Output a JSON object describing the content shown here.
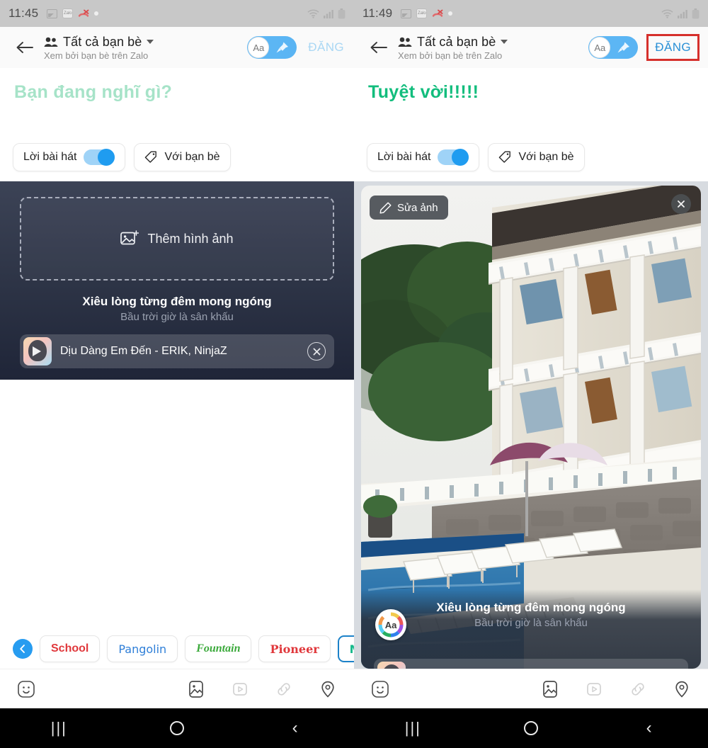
{
  "app": {
    "name": "Zalo",
    "accent": "#2a90d6",
    "caption_green": "#12bd7d",
    "highlight_red": "#d6302c"
  },
  "left": {
    "status": {
      "time": "11:45",
      "icons": [
        "gallery-icon",
        "zalo-icon",
        "missed-call-icon",
        "dot-icon",
        "wifi-icon",
        "signal-icon",
        "battery-icon"
      ]
    },
    "header": {
      "back": "back-arrow-icon",
      "title": "Tất cả bạn bè",
      "subtitle": "Xem bởi bạn bè trên Zalo",
      "aa_label": "Aa",
      "post_label": "ĐĂNG",
      "post_state": "inactive"
    },
    "caption": {
      "placeholder": "Bạn đang nghĩ gì?",
      "value": ""
    },
    "chips": [
      {
        "label": "Lời bài hát",
        "type": "toggle",
        "on": true
      },
      {
        "label": "Với bạn bè",
        "type": "tag"
      }
    ],
    "composer": {
      "add_photo_label": "Thêm hình ảnh",
      "lyric_main": "Xiêu lòng từng đêm mong ngóng",
      "lyric_sub": "Bầu trời giờ là sân khấu",
      "song_title": "Dịu Dàng Em Đến - ERIK, NinjaZ",
      "song_remove": "remove-song-icon"
    },
    "font_strip": {
      "scroll_left": "chevron-left-icon",
      "chips": [
        {
          "label": "School",
          "selected": false
        },
        {
          "label": "Pangolin",
          "selected": false
        },
        {
          "label": "Fountain",
          "selected": false
        },
        {
          "label": "Pioneer",
          "selected": false
        },
        {
          "label": "Maza",
          "selected": true
        }
      ]
    },
    "toolbar": {
      "emoji": "emoji-icon",
      "image": "image-icon",
      "video": "video-icon",
      "link": "link-icon",
      "location": "location-icon"
    },
    "navbar": {
      "recents": "|||",
      "home": "home-icon",
      "back": "‹"
    }
  },
  "right": {
    "status": {
      "time": "11:49",
      "icons": [
        "gallery-icon",
        "zalo-icon",
        "missed-call-icon",
        "dot-icon",
        "wifi-icon",
        "signal-icon",
        "battery-icon"
      ]
    },
    "header": {
      "back": "back-arrow-icon",
      "title": "Tất cả bạn bè",
      "subtitle": "Xem bởi bạn bè trên Zalo",
      "aa_label": "Aa",
      "post_label": "ĐĂNG",
      "post_state": "active-highlighted"
    },
    "caption": {
      "placeholder": "Bạn đang nghĩ gì?",
      "value": "Tuyệt vời!!!!!"
    },
    "chips": [
      {
        "label": "Lời bài hát",
        "type": "toggle",
        "on": true
      },
      {
        "label": "Với bạn bè",
        "type": "tag"
      }
    ],
    "photo": {
      "edit_label": "Sửa ảnh",
      "edit_icon": "pencil-icon",
      "close_icon": "close-icon",
      "alt": "resort building with swimming pool, lounge chairs and umbrella"
    },
    "overlay": {
      "lyric_main": "Xiêu lòng từng đêm mong ngóng",
      "lyric_sub": "Bầu trời giờ là sân khấu",
      "aa_label": "Aa"
    },
    "toolbar": {
      "emoji": "emoji-icon",
      "image": "image-icon",
      "video": "video-icon",
      "link": "link-icon",
      "location": "location-icon"
    },
    "navbar": {
      "recents": "|||",
      "home": "home-icon",
      "back": "‹"
    }
  }
}
